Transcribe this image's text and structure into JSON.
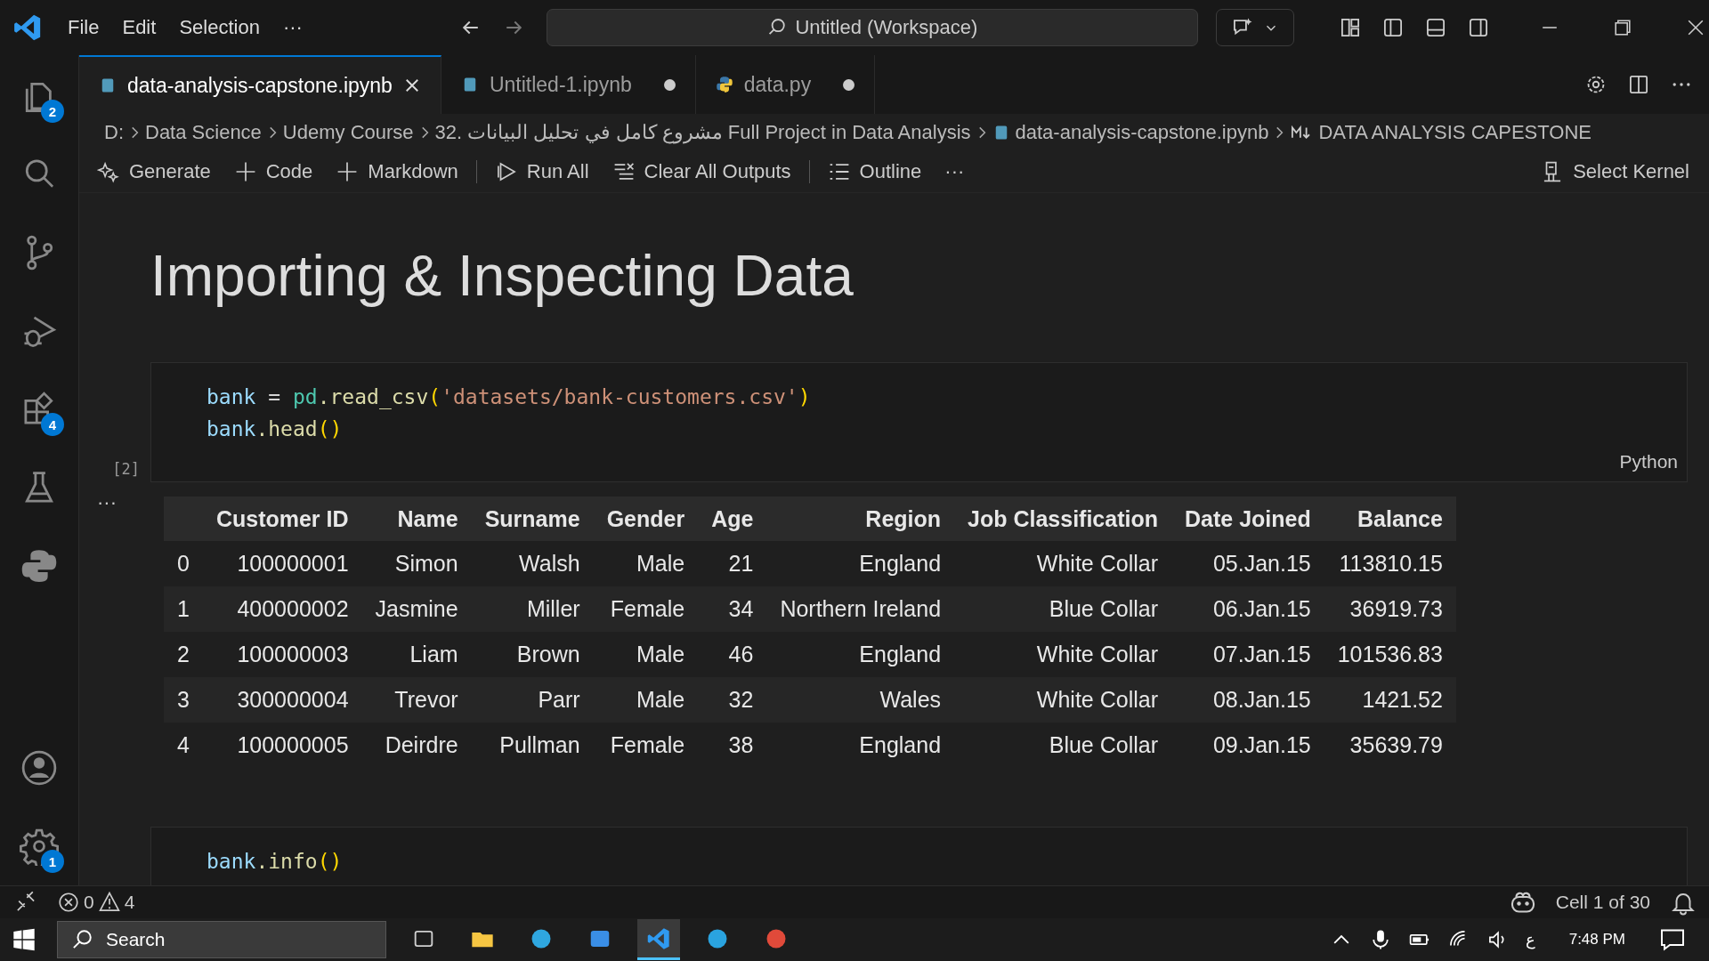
{
  "titlebar": {
    "menu": [
      "File",
      "Edit",
      "Selection",
      "···"
    ],
    "search": "Untitled (Workspace)"
  },
  "activity_bar": {
    "items": [
      {
        "kind": "files",
        "badge": "2"
      },
      {
        "kind": "search"
      },
      {
        "kind": "git"
      },
      {
        "kind": "debug"
      },
      {
        "kind": "extensions",
        "badge": "4"
      },
      {
        "kind": "testing"
      },
      {
        "kind": "python"
      }
    ],
    "bottom": [
      {
        "kind": "account"
      },
      {
        "kind": "settings",
        "badge": "1"
      }
    ]
  },
  "tabs": [
    {
      "label": "data-analysis-capstone.ipynb",
      "kind": "notebook",
      "selected": true,
      "dirty": false
    },
    {
      "label": "Untitled-1.ipynb",
      "kind": "notebook",
      "selected": false,
      "dirty": true
    },
    {
      "label": "data.py",
      "kind": "python",
      "selected": false,
      "dirty": true
    }
  ],
  "breadcrumb": [
    "D:",
    "Data Science",
    "Udemy Course",
    "32. مشروع كامل في تحليل البيانات  Full Project in Data Analysis",
    "data-analysis-capstone.ipynb",
    "DATA ANALYSIS CAPESTONE"
  ],
  "toolbar": {
    "items": [
      {
        "kind": "sparkle",
        "label": "Generate"
      },
      {
        "kind": "plus",
        "label": "Code"
      },
      {
        "kind": "plus",
        "label": "Markdown"
      },
      {
        "kind": "sep"
      },
      {
        "kind": "run",
        "label": "Run All"
      },
      {
        "kind": "clear",
        "label": "Clear All Outputs"
      },
      {
        "kind": "sep"
      },
      {
        "kind": "outline",
        "label": "Outline"
      },
      {
        "kind": "more",
        "label": "···"
      }
    ],
    "kernel": "Select Kernel"
  },
  "heading": "Importing & Inspecting Data",
  "cells": [
    {
      "exec": "[2]",
      "language": "Python",
      "lines": [
        [
          {
            "t": "bank",
            "kind": "var"
          },
          {
            "t": " = ",
            "kind": "op"
          },
          {
            "t": "pd",
            "kind": "module"
          },
          {
            "t": ".read_csv",
            "kind": "func"
          },
          {
            "t": "(",
            "kind": "paren"
          },
          {
            "t": "'datasets/bank-customers.csv'",
            "kind": "str"
          },
          {
            "t": ")",
            "kind": "paren"
          }
        ],
        [
          {
            "t": "bank",
            "kind": "var"
          },
          {
            "t": ".head",
            "kind": "func"
          },
          {
            "t": "()",
            "kind": "paren"
          }
        ]
      ]
    },
    {
      "lines": [
        [
          {
            "t": "bank",
            "kind": "var"
          },
          {
            "t": ".info",
            "kind": "func"
          },
          {
            "t": "()",
            "kind": "paren"
          }
        ]
      ]
    }
  ],
  "output": {
    "more": "···",
    "columns": [
      "",
      "Customer ID",
      "Name",
      "Surname",
      "Gender",
      "Age",
      "Region",
      "Job Classification",
      "Date Joined",
      "Balance"
    ],
    "rows": [
      [
        "0",
        "100000001",
        "Simon",
        "Walsh",
        "Male",
        "21",
        "England",
        "White Collar",
        "05.Jan.15",
        "113810.15"
      ],
      [
        "1",
        "400000002",
        "Jasmine",
        "Miller",
        "Female",
        "34",
        "Northern Ireland",
        "Blue Collar",
        "06.Jan.15",
        "36919.73"
      ],
      [
        "2",
        "100000003",
        "Liam",
        "Brown",
        "Male",
        "46",
        "England",
        "White Collar",
        "07.Jan.15",
        "101536.83"
      ],
      [
        "3",
        "300000004",
        "Trevor",
        "Parr",
        "Male",
        "32",
        "Wales",
        "White Collar",
        "08.Jan.15",
        "1421.52"
      ],
      [
        "4",
        "100000005",
        "Deirdre",
        "Pullman",
        "Female",
        "38",
        "England",
        "Blue Collar",
        "09.Jan.15",
        "35639.79"
      ]
    ]
  },
  "status_bar": {
    "errors": "0",
    "warnings": "4",
    "cell": "Cell 1 of 30"
  },
  "taskbar": {
    "search": "Search",
    "apps": [
      {
        "kind": "taskview",
        "selected": false
      },
      {
        "kind": "explorer",
        "selected": false
      },
      {
        "kind": "edge",
        "selected": false
      },
      {
        "kind": "store",
        "selected": false
      },
      {
        "kind": "vscode",
        "selected": true
      },
      {
        "kind": "telegram",
        "selected": false
      },
      {
        "kind": "chrome",
        "selected": false
      }
    ],
    "lang": "ع",
    "time": "7:48 PM"
  }
}
